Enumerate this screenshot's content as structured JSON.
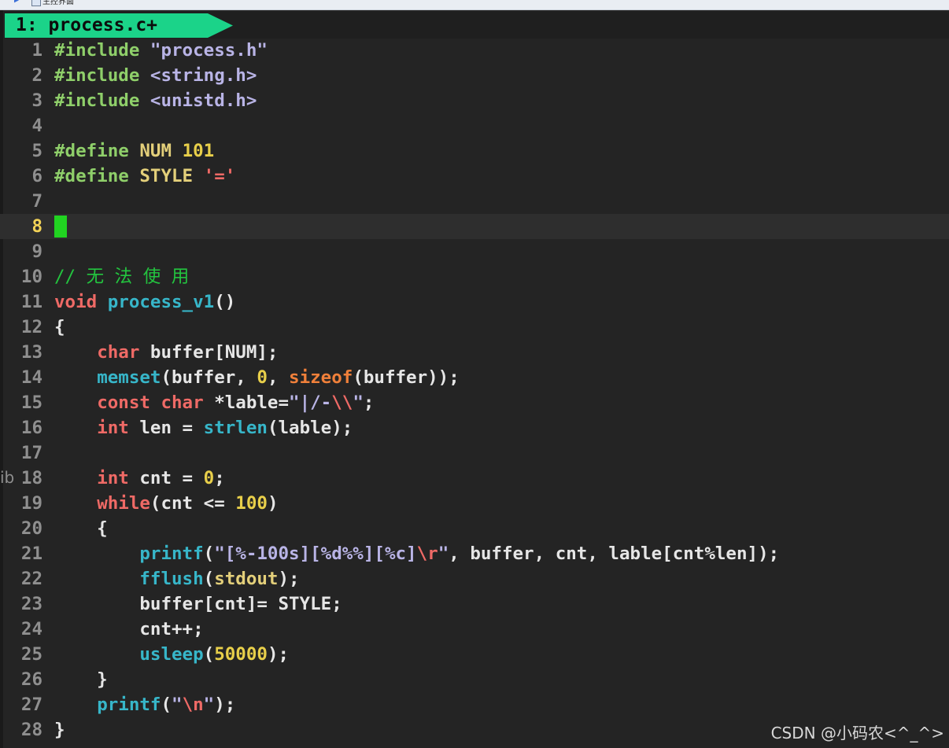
{
  "window": {
    "title": "主控界面"
  },
  "tab": {
    "label": "1: process.c+"
  },
  "cursor_line": 8,
  "lines": [
    {
      "n": "1",
      "tokens": [
        {
          "t": "#include ",
          "c": "t-pre"
        },
        {
          "t": "\"process.h\"",
          "c": "t-str"
        }
      ]
    },
    {
      "n": "2",
      "tokens": [
        {
          "t": "#include ",
          "c": "t-pre"
        },
        {
          "t": "<string.h>",
          "c": "t-str"
        }
      ]
    },
    {
      "n": "3",
      "tokens": [
        {
          "t": "#include ",
          "c": "t-pre"
        },
        {
          "t": "<unistd.h>",
          "c": "t-str"
        }
      ]
    },
    {
      "n": "4",
      "tokens": []
    },
    {
      "n": "5",
      "tokens": [
        {
          "t": "#define ",
          "c": "t-pre"
        },
        {
          "t": "NUM ",
          "c": "t-name"
        },
        {
          "t": "101",
          "c": "t-num"
        }
      ]
    },
    {
      "n": "6",
      "tokens": [
        {
          "t": "#define ",
          "c": "t-pre"
        },
        {
          "t": "STYLE ",
          "c": "t-name"
        },
        {
          "t": "'='",
          "c": "t-type"
        }
      ]
    },
    {
      "n": "7",
      "tokens": []
    },
    {
      "n": "8",
      "tokens": []
    },
    {
      "n": "9",
      "tokens": []
    },
    {
      "n": "10",
      "tokens": [
        {
          "t": "// 无 法 使 用",
          "c": "t-com"
        }
      ]
    },
    {
      "n": "11",
      "tokens": [
        {
          "t": "void ",
          "c": "t-type"
        },
        {
          "t": "process_v1",
          "c": "t-fn"
        },
        {
          "t": "()",
          "c": "t-def"
        }
      ]
    },
    {
      "n": "12",
      "tokens": [
        {
          "t": "{",
          "c": "t-def"
        }
      ]
    },
    {
      "n": "13",
      "tokens": [
        {
          "t": "    ",
          "c": "t-def"
        },
        {
          "t": "char ",
          "c": "t-type"
        },
        {
          "t": "buffer[NUM];",
          "c": "t-def"
        }
      ]
    },
    {
      "n": "14",
      "tokens": [
        {
          "t": "    ",
          "c": "t-def"
        },
        {
          "t": "memset",
          "c": "t-fn"
        },
        {
          "t": "(buffer, ",
          "c": "t-def"
        },
        {
          "t": "0",
          "c": "t-num"
        },
        {
          "t": ", ",
          "c": "t-def"
        },
        {
          "t": "sizeof",
          "c": "t-kw2"
        },
        {
          "t": "(buffer));",
          "c": "t-def"
        }
      ]
    },
    {
      "n": "15",
      "tokens": [
        {
          "t": "    ",
          "c": "t-def"
        },
        {
          "t": "const ",
          "c": "t-type"
        },
        {
          "t": "char ",
          "c": "t-type"
        },
        {
          "t": "*lable=",
          "c": "t-def"
        },
        {
          "t": "\"|/-",
          "c": "t-str"
        },
        {
          "t": "\\\\",
          "c": "t-esc"
        },
        {
          "t": "\"",
          "c": "t-str"
        },
        {
          "t": ";",
          "c": "t-def"
        }
      ]
    },
    {
      "n": "16",
      "tokens": [
        {
          "t": "    ",
          "c": "t-def"
        },
        {
          "t": "int ",
          "c": "t-type"
        },
        {
          "t": "len = ",
          "c": "t-def"
        },
        {
          "t": "strlen",
          "c": "t-fn"
        },
        {
          "t": "(lable);",
          "c": "t-def"
        }
      ]
    },
    {
      "n": "17",
      "tokens": []
    },
    {
      "n": "18",
      "tokens": [
        {
          "t": "    ",
          "c": "t-def"
        },
        {
          "t": "int ",
          "c": "t-type"
        },
        {
          "t": "cnt = ",
          "c": "t-def"
        },
        {
          "t": "0",
          "c": "t-num"
        },
        {
          "t": ";",
          "c": "t-def"
        }
      ]
    },
    {
      "n": "19",
      "tokens": [
        {
          "t": "    ",
          "c": "t-def"
        },
        {
          "t": "while",
          "c": "t-type"
        },
        {
          "t": "(cnt <= ",
          "c": "t-def"
        },
        {
          "t": "100",
          "c": "t-num"
        },
        {
          "t": ")",
          "c": "t-def"
        }
      ]
    },
    {
      "n": "20",
      "tokens": [
        {
          "t": "    {",
          "c": "t-def"
        }
      ]
    },
    {
      "n": "21",
      "tokens": [
        {
          "t": "        ",
          "c": "t-def"
        },
        {
          "t": "printf",
          "c": "t-fn"
        },
        {
          "t": "(",
          "c": "t-def"
        },
        {
          "t": "\"[%-100s][%d%%][%c]",
          "c": "t-str"
        },
        {
          "t": "\\r",
          "c": "t-esc"
        },
        {
          "t": "\"",
          "c": "t-str"
        },
        {
          "t": ", buffer, cnt, lable[cnt%len]);",
          "c": "t-def"
        }
      ]
    },
    {
      "n": "22",
      "tokens": [
        {
          "t": "        ",
          "c": "t-def"
        },
        {
          "t": "fflush",
          "c": "t-fn"
        },
        {
          "t": "(",
          "c": "t-def"
        },
        {
          "t": "stdout",
          "c": "t-name"
        },
        {
          "t": ");",
          "c": "t-def"
        }
      ]
    },
    {
      "n": "23",
      "tokens": [
        {
          "t": "        buffer[cnt]= STYLE;",
          "c": "t-def"
        }
      ]
    },
    {
      "n": "24",
      "tokens": [
        {
          "t": "        cnt++;",
          "c": "t-def"
        }
      ]
    },
    {
      "n": "25",
      "tokens": [
        {
          "t": "        ",
          "c": "t-def"
        },
        {
          "t": "usleep",
          "c": "t-fn"
        },
        {
          "t": "(",
          "c": "t-def"
        },
        {
          "t": "50000",
          "c": "t-num"
        },
        {
          "t": ");",
          "c": "t-def"
        }
      ]
    },
    {
      "n": "26",
      "tokens": [
        {
          "t": "    }",
          "c": "t-def"
        }
      ]
    },
    {
      "n": "27",
      "tokens": [
        {
          "t": "    ",
          "c": "t-def"
        },
        {
          "t": "printf",
          "c": "t-fn"
        },
        {
          "t": "(",
          "c": "t-def"
        },
        {
          "t": "\"",
          "c": "t-str"
        },
        {
          "t": "\\n",
          "c": "t-esc"
        },
        {
          "t": "\"",
          "c": "t-str"
        },
        {
          "t": ");",
          "c": "t-def"
        }
      ]
    },
    {
      "n": "28",
      "tokens": [
        {
          "t": "}",
          "c": "t-def"
        }
      ]
    }
  ],
  "gutter_fragment": "ib",
  "watermark": "CSDN @小码农<^_^>",
  "colors": {
    "background": "#242424",
    "tab": "#1bd389",
    "cursor": "#21d321",
    "current_line": "#2e2e2e"
  }
}
